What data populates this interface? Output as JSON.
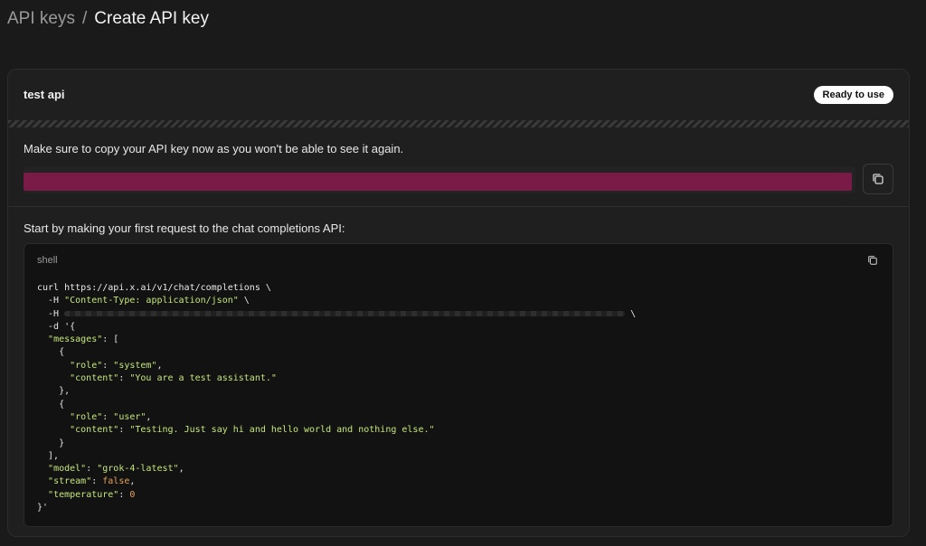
{
  "breadcrumb": {
    "parent": "API keys",
    "separator": "/",
    "current": "Create API key"
  },
  "card": {
    "key_name": "test api",
    "status": "Ready to use",
    "warning": "Make sure to copy your API key now as you won't be able to see it again.",
    "request_intro": "Start by making your first request to the chat completions API:"
  },
  "code": {
    "language": "shell",
    "url": "https://api.x.ai/v1/chat/completions",
    "header_content_type": "\"Content-Type: application/json\"",
    "role_system": "\"system\"",
    "content_system": "\"You are a test assistant.\"",
    "role_user": "\"user\"",
    "content_user": "\"Testing. Just say hi and hello world and nothing else.\"",
    "model": "\"grok-4-latest\"",
    "stream": "false",
    "temperature": "0"
  },
  "colors": {
    "background": "#1a1a1a",
    "card": "#1f1f1f",
    "key_redaction": "#7a1a47",
    "string": "#c5e67a",
    "keyword": "#e8a05a"
  },
  "icons": {
    "copy_key": "copy-icon",
    "copy_code": "copy-icon"
  }
}
